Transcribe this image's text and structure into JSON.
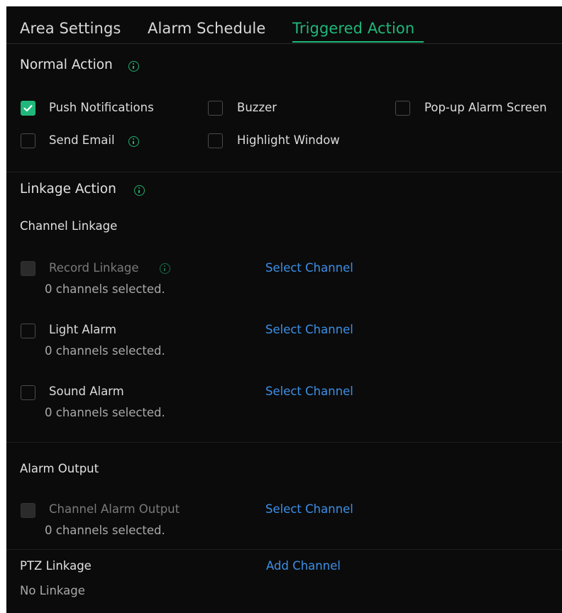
{
  "tabs": [
    {
      "label": "Area Settings",
      "active": false
    },
    {
      "label": "Alarm Schedule",
      "active": false
    },
    {
      "label": "Triggered Action",
      "active": true
    }
  ],
  "colors": {
    "accent": "#1fb87a",
    "link": "#3d8fe6",
    "background": "#0b0b0b"
  },
  "normal_action": {
    "title": "Normal Action",
    "options": [
      {
        "label": "Push Notifications",
        "checked": true
      },
      {
        "label": "Buzzer",
        "checked": false
      },
      {
        "label": "Pop-up Alarm Screen",
        "checked": false
      },
      {
        "label": "Send Email",
        "checked": false
      },
      {
        "label": "Highlight Window",
        "checked": false
      }
    ]
  },
  "linkage_action": {
    "title": "Linkage Action",
    "channel_linkage": {
      "title": "Channel Linkage",
      "items": [
        {
          "label": "Record Linkage",
          "status": "0 channels selected.",
          "link": "Select Channel",
          "checked": false,
          "disabled": true
        },
        {
          "label": "Light Alarm",
          "status": "0 channels selected.",
          "link": "Select Channel",
          "checked": false,
          "disabled": false
        },
        {
          "label": "Sound Alarm",
          "status": "0 channels selected.",
          "link": "Select Channel",
          "checked": false,
          "disabled": false
        }
      ]
    },
    "alarm_output": {
      "title": "Alarm Output",
      "items": [
        {
          "label": "Channel Alarm Output",
          "status": "0 channels selected.",
          "link": "Select Channel",
          "checked": false,
          "disabled": true
        }
      ]
    },
    "ptz_linkage": {
      "title": "PTZ Linkage",
      "link": "Add Channel",
      "status": "No Linkage"
    }
  }
}
